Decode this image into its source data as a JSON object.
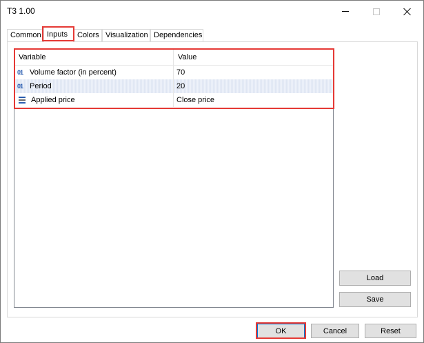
{
  "window": {
    "title": "T3 1.00"
  },
  "tabs": [
    {
      "label": "Common"
    },
    {
      "label": "Inputs"
    },
    {
      "label": "Colors"
    },
    {
      "label": "Visualization"
    },
    {
      "label": "Dependencies"
    }
  ],
  "active_tab": "Inputs",
  "grid": {
    "headers": {
      "variable": "Variable",
      "value": "Value"
    },
    "rows": [
      {
        "icon": "numeric-icon",
        "icon_text": "01",
        "variable": "Volume factor (in percent)",
        "value": "70"
      },
      {
        "icon": "numeric-icon",
        "icon_text": "01",
        "variable": "Period",
        "value": "20"
      },
      {
        "icon": "enum-list-icon",
        "variable": "Applied price",
        "value": "Close price"
      }
    ]
  },
  "side_buttons": {
    "load": "Load",
    "save": "Save"
  },
  "footer_buttons": {
    "ok": "OK",
    "cancel": "Cancel",
    "reset": "Reset"
  },
  "colors": {
    "highlight": "#e53935",
    "numeric_icon": "#2a5db0",
    "ok_border": "#0078d7"
  }
}
